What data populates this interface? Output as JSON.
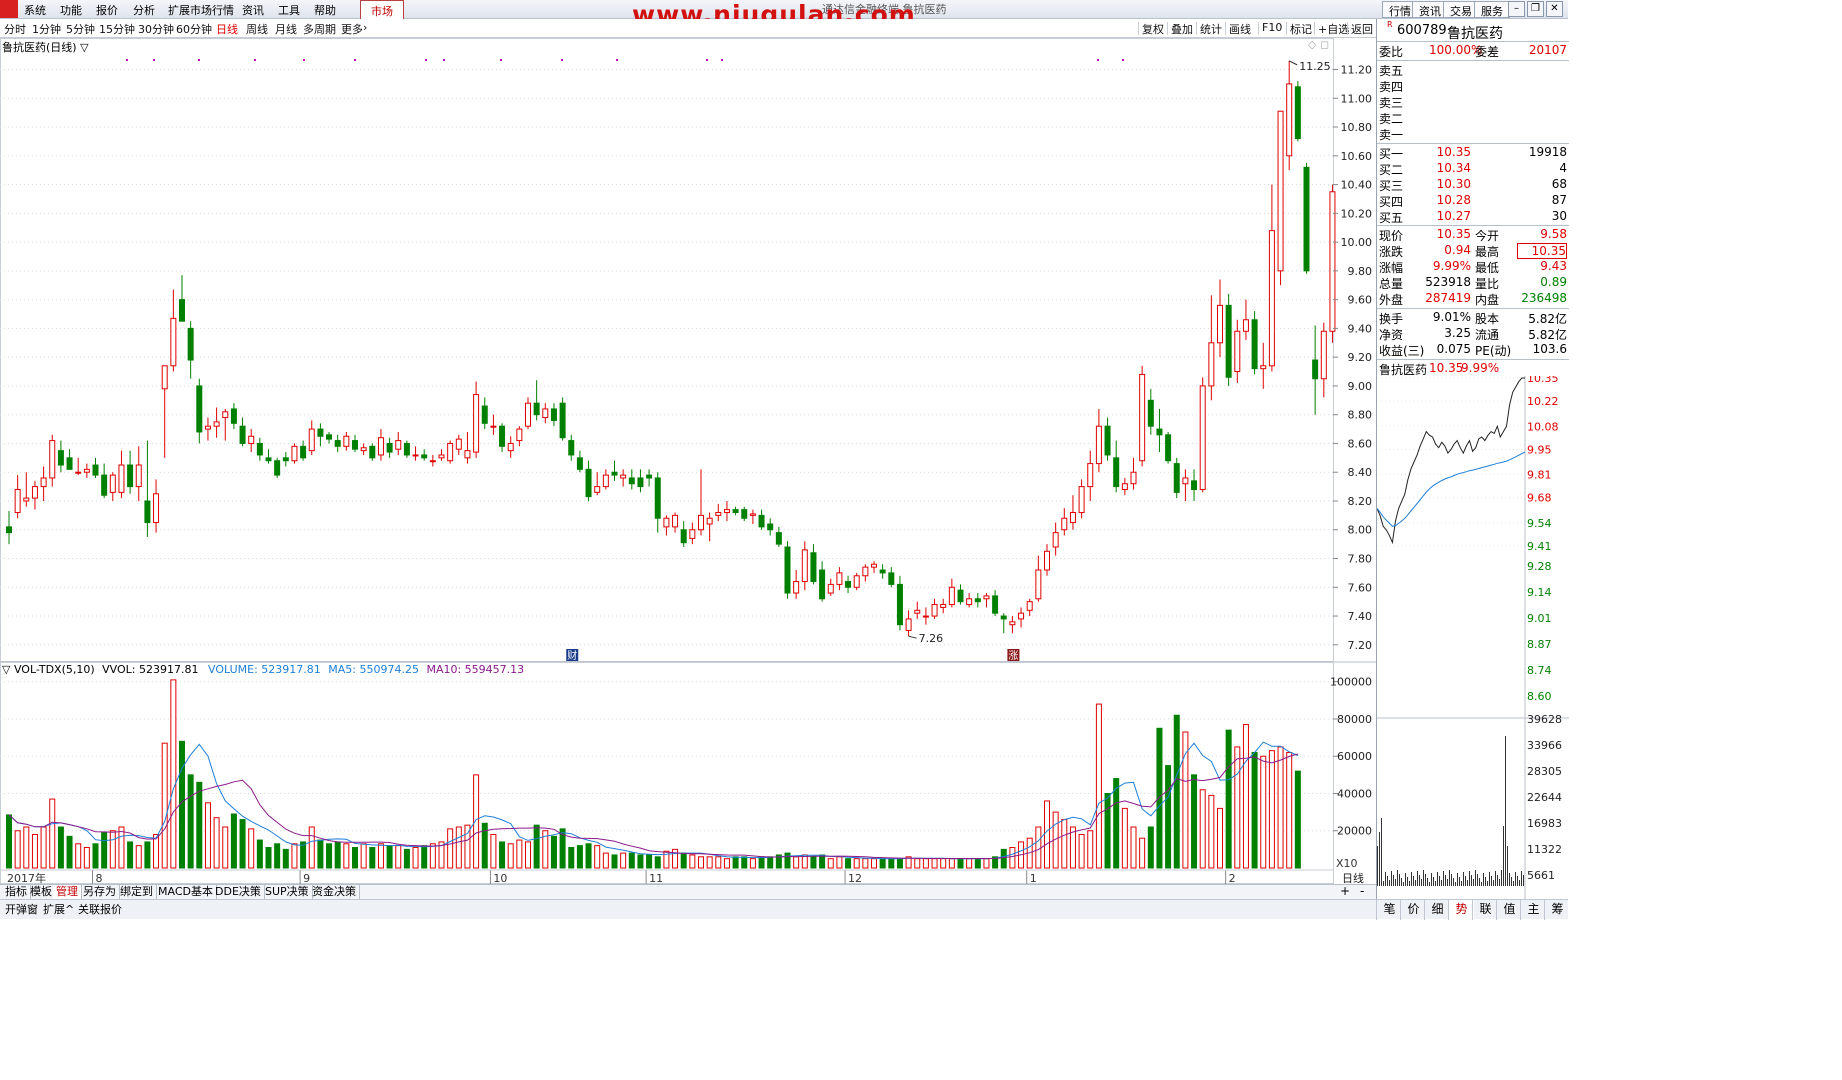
{
  "menu": {
    "items": [
      "系统",
      "功能",
      "报价",
      "分析",
      "扩展市场行情",
      "资讯",
      "工具",
      "帮助"
    ],
    "market_tab": "市场",
    "watermark": "www.niugulan.com",
    "marquee": "通达信金融终端  鲁抗医药",
    "top_buttons": [
      "行情",
      "资讯",
      "交易",
      "服务"
    ]
  },
  "periods": {
    "items": [
      "分时",
      "1分钟",
      "5分钟",
      "15分钟",
      "30分钟",
      "60分钟",
      "日线",
      "周线",
      "月线",
      "多周期",
      "更多"
    ],
    "active": "日线"
  },
  "toolbar": {
    "items": [
      "复权",
      "叠加",
      "统计",
      "画线",
      "F10",
      "标记",
      "+自选",
      "返回"
    ]
  },
  "main": {
    "title": "鲁抗医药(日线)",
    "max_label": "11.25",
    "min_label": "7.26",
    "event_markers": [
      {
        "label": "财",
        "bar_index": 65
      },
      {
        "label": "涨",
        "bar_index": 116
      }
    ]
  },
  "volume_panel": {
    "title": "VOL-TDX(5,10)",
    "vvol": "VVOL: 523917.81",
    "volume": "VOLUME: 523917.81",
    "ma5": "MA5: 550974.25",
    "ma10": "MA10: 559457.13",
    "scale_note": "X10"
  },
  "x_axis": {
    "labels": [
      "2017年",
      "8",
      "9",
      "10",
      "11",
      "12",
      "1",
      "2"
    ],
    "right_label": "日线"
  },
  "bottom_tabs": {
    "items": [
      "指标",
      "模板",
      "管理",
      "另存为",
      "绑定到",
      "MACD基本",
      "DDE决策",
      "SUP决策",
      "资金决策"
    ],
    "active": "管理"
  },
  "status_tabs": {
    "items": [
      "开弹窗",
      "扩展^",
      "关联报价"
    ]
  },
  "right_tabs": {
    "items": [
      "笔",
      "价",
      "细",
      "势",
      "联",
      "值",
      "主",
      "筹"
    ],
    "active": "势"
  },
  "quote": {
    "badge": "R",
    "code": "600789",
    "name": "鲁抗医药",
    "weibi_label": "委比",
    "weibi": "100.00%",
    "weicha_label": "委差",
    "weicha": "20107",
    "sells": [
      {
        "label": "卖五",
        "price": "",
        "vol": ""
      },
      {
        "label": "卖四",
        "price": "",
        "vol": ""
      },
      {
        "label": "卖三",
        "price": "",
        "vol": ""
      },
      {
        "label": "卖二",
        "price": "",
        "vol": ""
      },
      {
        "label": "卖一",
        "price": "",
        "vol": ""
      }
    ],
    "buys": [
      {
        "label": "买一",
        "price": "10.35",
        "vol": "19918"
      },
      {
        "label": "买二",
        "price": "10.34",
        "vol": "4"
      },
      {
        "label": "买三",
        "price": "10.30",
        "vol": "68"
      },
      {
        "label": "买四",
        "price": "10.28",
        "vol": "87"
      },
      {
        "label": "买五",
        "price": "10.27",
        "vol": "30"
      }
    ],
    "stats1": [
      {
        "l1": "现价",
        "v1": "10.35",
        "c1": "red",
        "l2": "今开",
        "v2": "9.58",
        "c2": "red"
      },
      {
        "l1": "涨跌",
        "v1": "0.94",
        "c1": "red",
        "l2": "最高",
        "v2": "10.35",
        "c2": "red"
      },
      {
        "l1": "涨幅",
        "v1": "9.99%",
        "c1": "red",
        "l2": "最低",
        "v2": "9.43",
        "c2": "red"
      },
      {
        "l1": "总量",
        "v1": "523918",
        "c1": "blk",
        "l2": "量比",
        "v2": "0.89",
        "c2": "green"
      },
      {
        "l1": "外盘",
        "v1": "287419",
        "c1": "red",
        "l2": "内盘",
        "v2": "236498",
        "c2": "green"
      }
    ],
    "stats2": [
      {
        "l1": "换手",
        "v1": "9.01%",
        "l2": "股本",
        "v2": "5.82亿"
      },
      {
        "l1": "净资",
        "v1": "3.25",
        "l2": "流通",
        "v2": "5.82亿"
      },
      {
        "l1": "收益(三)",
        "v1": "0.075",
        "l2": "PE(动)",
        "v2": "103.6"
      }
    ],
    "mini_title": "鲁抗医药",
    "mini_price": "10.35",
    "mini_pct": "9.99%"
  },
  "colors": {
    "up": "#e00000",
    "down": "#008000",
    "ma5": "#1e7fd8",
    "ma10": "#8b1a8b"
  },
  "chart_data": [
    {
      "type": "candlestick",
      "title": "鲁抗医药(日线)",
      "y_ticks": [
        7.2,
        7.4,
        7.6,
        7.8,
        8.0,
        8.2,
        8.4,
        8.6,
        8.8,
        9.0,
        9.2,
        9.4,
        9.6,
        9.8,
        10.0,
        10.2,
        10.4,
        10.6,
        10.8,
        11.0,
        11.2
      ],
      "ylim": [
        7.15,
        11.28
      ],
      "ohlc": [
        [
          8.02,
          8.13,
          7.9,
          7.98
        ],
        [
          8.12,
          8.38,
          8.08,
          8.28
        ],
        [
          8.2,
          8.4,
          8.16,
          8.22
        ],
        [
          8.22,
          8.34,
          8.14,
          8.3
        ],
        [
          8.3,
          8.44,
          8.2,
          8.36
        ],
        [
          8.36,
          8.66,
          8.3,
          8.62
        ],
        [
          8.55,
          8.62,
          8.4,
          8.45
        ],
        [
          8.5,
          8.56,
          8.42,
          8.42
        ],
        [
          8.4,
          8.5,
          8.38,
          8.4
        ],
        [
          8.4,
          8.46,
          8.36,
          8.42
        ],
        [
          8.45,
          8.5,
          8.36,
          8.38
        ],
        [
          8.38,
          8.46,
          8.22,
          8.24
        ],
        [
          8.26,
          8.4,
          8.2,
          8.38
        ],
        [
          8.26,
          8.55,
          8.22,
          8.45
        ],
        [
          8.45,
          8.55,
          8.25,
          8.3
        ],
        [
          8.3,
          8.58,
          8.2,
          8.45
        ],
        [
          8.2,
          8.62,
          7.95,
          8.05
        ],
        [
          8.05,
          8.35,
          7.98,
          8.25
        ],
        [
          8.98,
          9.05,
          8.5,
          9.14
        ],
        [
          9.14,
          9.67,
          9.1,
          9.47
        ],
        [
          9.6,
          9.77,
          9.45,
          9.45
        ],
        [
          9.4,
          9.45,
          9.05,
          9.18
        ],
        [
          9.0,
          9.05,
          8.6,
          8.68
        ],
        [
          8.7,
          8.78,
          8.62,
          8.72
        ],
        [
          8.72,
          8.85,
          8.64,
          8.75
        ],
        [
          8.78,
          8.84,
          8.62,
          8.82
        ],
        [
          8.84,
          8.88,
          8.7,
          8.74
        ],
        [
          8.72,
          8.78,
          8.58,
          8.6
        ],
        [
          8.6,
          8.7,
          8.54,
          8.65
        ],
        [
          8.6,
          8.64,
          8.48,
          8.52
        ],
        [
          8.5,
          8.56,
          8.46,
          8.48
        ],
        [
          8.48,
          8.5,
          8.36,
          8.38
        ],
        [
          8.5,
          8.54,
          8.44,
          8.48
        ],
        [
          8.48,
          8.6,
          8.46,
          8.58
        ],
        [
          8.58,
          8.62,
          8.48,
          8.5
        ],
        [
          8.55,
          8.76,
          8.52,
          8.7
        ],
        [
          8.7,
          8.74,
          8.58,
          8.65
        ],
        [
          8.66,
          8.68,
          8.6,
          8.63
        ],
        [
          8.62,
          8.66,
          8.54,
          8.58
        ],
        [
          8.58,
          8.68,
          8.55,
          8.65
        ],
        [
          8.62,
          8.66,
          8.54,
          8.56
        ],
        [
          8.55,
          8.6,
          8.52,
          8.57
        ],
        [
          8.58,
          8.6,
          8.48,
          8.5
        ],
        [
          8.52,
          8.7,
          8.48,
          8.64
        ],
        [
          8.6,
          8.64,
          8.5,
          8.54
        ],
        [
          8.56,
          8.68,
          8.52,
          8.62
        ],
        [
          8.6,
          8.62,
          8.5,
          8.52
        ],
        [
          8.52,
          8.58,
          8.48,
          8.52
        ],
        [
          8.52,
          8.56,
          8.48,
          8.5
        ],
        [
          8.48,
          8.52,
          8.44,
          8.48
        ],
        [
          8.5,
          8.56,
          8.48,
          8.52
        ],
        [
          8.48,
          8.62,
          8.46,
          8.6
        ],
        [
          8.56,
          8.66,
          8.52,
          8.63
        ],
        [
          8.5,
          8.68,
          8.46,
          8.55
        ],
        [
          8.54,
          9.03,
          8.5,
          8.94
        ],
        [
          8.86,
          8.92,
          8.7,
          8.74
        ],
        [
          8.72,
          8.8,
          8.66,
          8.72
        ],
        [
          8.72,
          8.74,
          8.54,
          8.58
        ],
        [
          8.55,
          8.65,
          8.5,
          8.6
        ],
        [
          8.62,
          8.72,
          8.58,
          8.7
        ],
        [
          8.72,
          8.92,
          8.7,
          8.88
        ],
        [
          8.88,
          9.04,
          8.76,
          8.8
        ],
        [
          8.78,
          8.88,
          8.74,
          8.84
        ],
        [
          8.84,
          8.88,
          8.72,
          8.76
        ],
        [
          8.88,
          8.92,
          8.62,
          8.64
        ],
        [
          8.62,
          8.66,
          8.48,
          8.52
        ],
        [
          8.5,
          8.55,
          8.4,
          8.42
        ],
        [
          8.42,
          8.48,
          8.2,
          8.23
        ],
        [
          8.26,
          8.4,
          8.24,
          8.3
        ],
        [
          8.3,
          8.42,
          8.28,
          8.38
        ],
        [
          8.4,
          8.48,
          8.34,
          8.38
        ],
        [
          8.36,
          8.42,
          8.3,
          8.38
        ],
        [
          8.36,
          8.42,
          8.28,
          8.32
        ],
        [
          8.36,
          8.42,
          8.26,
          8.3
        ],
        [
          8.38,
          8.42,
          8.3,
          8.36
        ],
        [
          8.36,
          8.4,
          7.98,
          8.08
        ],
        [
          8.02,
          8.1,
          7.96,
          8.08
        ],
        [
          8.02,
          8.12,
          7.98,
          8.1
        ],
        [
          8.0,
          8.06,
          7.88,
          7.91
        ],
        [
          7.94,
          8.05,
          7.9,
          8.0
        ],
        [
          8.0,
          8.42,
          7.96,
          8.1
        ],
        [
          8.04,
          8.12,
          7.92,
          8.08
        ],
        [
          8.1,
          8.18,
          8.06,
          8.12
        ],
        [
          8.12,
          8.2,
          8.06,
          8.14
        ],
        [
          8.14,
          8.16,
          8.1,
          8.12
        ],
        [
          8.14,
          8.16,
          8.06,
          8.08
        ],
        [
          8.1,
          8.14,
          8.04,
          8.11
        ],
        [
          8.1,
          8.14,
          8.0,
          8.02
        ],
        [
          8.04,
          8.08,
          7.96,
          8.0
        ],
        [
          7.98,
          8.02,
          7.88,
          7.9
        ],
        [
          7.88,
          7.92,
          7.52,
          7.56
        ],
        [
          7.56,
          7.72,
          7.52,
          7.64
        ],
        [
          7.64,
          7.92,
          7.58,
          7.86
        ],
        [
          7.84,
          7.9,
          7.62,
          7.64
        ],
        [
          7.72,
          7.78,
          7.5,
          7.52
        ],
        [
          7.56,
          7.66,
          7.54,
          7.62
        ],
        [
          7.62,
          7.74,
          7.58,
          7.7
        ],
        [
          7.64,
          7.68,
          7.56,
          7.6
        ],
        [
          7.6,
          7.7,
          7.58,
          7.68
        ],
        [
          7.68,
          7.76,
          7.64,
          7.74
        ],
        [
          7.74,
          7.78,
          7.7,
          7.76
        ],
        [
          7.72,
          7.76,
          7.66,
          7.7
        ],
        [
          7.7,
          7.74,
          7.6,
          7.62
        ],
        [
          7.62,
          7.68,
          7.3,
          7.34
        ],
        [
          7.3,
          7.44,
          7.26,
          7.38
        ],
        [
          7.42,
          7.5,
          7.38,
          7.44
        ],
        [
          7.4,
          7.46,
          7.34,
          7.4
        ],
        [
          7.4,
          7.52,
          7.38,
          7.48
        ],
        [
          7.46,
          7.52,
          7.42,
          7.48
        ],
        [
          7.48,
          7.66,
          7.46,
          7.6
        ],
        [
          7.58,
          7.62,
          7.48,
          7.5
        ],
        [
          7.48,
          7.56,
          7.46,
          7.52
        ],
        [
          7.52,
          7.56,
          7.46,
          7.5
        ],
        [
          7.52,
          7.56,
          7.46,
          7.54
        ],
        [
          7.54,
          7.58,
          7.4,
          7.42
        ],
        [
          7.4,
          7.42,
          7.28,
          7.38
        ],
        [
          7.34,
          7.4,
          7.28,
          7.36
        ],
        [
          7.38,
          7.46,
          7.32,
          7.42
        ],
        [
          7.44,
          7.52,
          7.4,
          7.5
        ],
        [
          7.52,
          7.82,
          7.5,
          7.72
        ],
        [
          7.72,
          7.9,
          7.68,
          7.85
        ],
        [
          7.88,
          8.05,
          7.82,
          7.98
        ],
        [
          8.0,
          8.15,
          7.96,
          8.08
        ],
        [
          8.05,
          8.24,
          8.0,
          8.12
        ],
        [
          8.12,
          8.35,
          8.08,
          8.3
        ],
        [
          8.3,
          8.55,
          8.2,
          8.46
        ],
        [
          8.46,
          8.84,
          8.4,
          8.72
        ],
        [
          8.72,
          8.78,
          8.48,
          8.52
        ],
        [
          8.5,
          8.62,
          8.26,
          8.3
        ],
        [
          8.28,
          8.36,
          8.24,
          8.32
        ],
        [
          8.32,
          8.5,
          8.28,
          8.4
        ],
        [
          8.48,
          9.14,
          8.44,
          9.08
        ],
        [
          8.9,
          8.98,
          8.66,
          8.72
        ],
        [
          8.7,
          8.84,
          8.54,
          8.66
        ],
        [
          8.66,
          8.68,
          8.46,
          8.48
        ],
        [
          8.46,
          8.5,
          8.22,
          8.26
        ],
        [
          8.32,
          8.42,
          8.2,
          8.36
        ],
        [
          8.34,
          8.42,
          8.2,
          8.28
        ],
        [
          8.28,
          9.06,
          8.26,
          9.0
        ],
        [
          9.0,
          9.63,
          8.9,
          9.3
        ],
        [
          9.3,
          9.74,
          9.2,
          9.56
        ],
        [
          9.56,
          9.64,
          9.0,
          9.06
        ],
        [
          9.1,
          9.46,
          9.02,
          9.38
        ],
        [
          9.38,
          9.6,
          9.32,
          9.46
        ],
        [
          9.46,
          9.52,
          9.08,
          9.12
        ],
        [
          9.12,
          9.3,
          8.98,
          9.14
        ],
        [
          9.14,
          10.4,
          9.1,
          10.08
        ],
        [
          9.8,
          10.4,
          9.7,
          10.91
        ],
        [
          10.6,
          11.26,
          10.5,
          11.1
        ],
        [
          11.08,
          11.12,
          10.7,
          10.72
        ],
        [
          10.52,
          10.55,
          9.78,
          9.8
        ],
        [
          9.18,
          9.42,
          8.8,
          9.05
        ],
        [
          9.05,
          9.44,
          8.92,
          9.38
        ],
        [
          9.38,
          10.4,
          9.3,
          10.35
        ]
      ]
    },
    {
      "type": "bar",
      "title": "VOL-TDX(5,10)",
      "y_ticks": [
        20000,
        40000,
        60000,
        80000,
        100000
      ],
      "ylim": [
        0,
        102000
      ],
      "values": [
        28500,
        20000,
        22000,
        18000,
        22000,
        37000,
        22000,
        17000,
        13000,
        11000,
        13000,
        19000,
        20000,
        22000,
        14000,
        12000,
        14000,
        18000,
        67000,
        101000,
        68000,
        50000,
        46000,
        35000,
        27000,
        22000,
        29000,
        26000,
        21000,
        15000,
        11000,
        13000,
        10000,
        13000,
        14000,
        22000,
        15000,
        13000,
        14000,
        13000,
        11000,
        13000,
        11000,
        13000,
        12000,
        12000,
        10000,
        11000,
        12000,
        13000,
        14000,
        21000,
        22000,
        23000,
        50000,
        24000,
        18000,
        14000,
        13000,
        15000,
        14000,
        23000,
        20000,
        17000,
        21000,
        11000,
        12000,
        13000,
        12000,
        8000,
        7000,
        8000,
        8000,
        7000,
        7000,
        6000,
        9000,
        10000,
        8000,
        7000,
        6000,
        6000,
        6000,
        5000,
        6000,
        6000,
        5000,
        6000,
        6000,
        7000,
        8000,
        6000,
        7000,
        6000,
        7000,
        5000,
        6000,
        5000,
        5000,
        5000,
        5000,
        5000,
        5000,
        5000,
        6000,
        5000,
        5000,
        5000,
        5000,
        5000,
        5000,
        5000,
        5000,
        5000,
        6000,
        10000,
        11000,
        14000,
        16000,
        22000,
        36000,
        30000,
        26000,
        22000,
        18000,
        20000,
        88000,
        40000,
        48000,
        32000,
        22000,
        16000,
        22000,
        75000,
        55000,
        82000,
        73000,
        50000,
        42000,
        39000,
        32000,
        74000,
        65000,
        77000,
        62000,
        60000,
        63000,
        65000,
        62000,
        52000
      ]
    }
  ]
}
